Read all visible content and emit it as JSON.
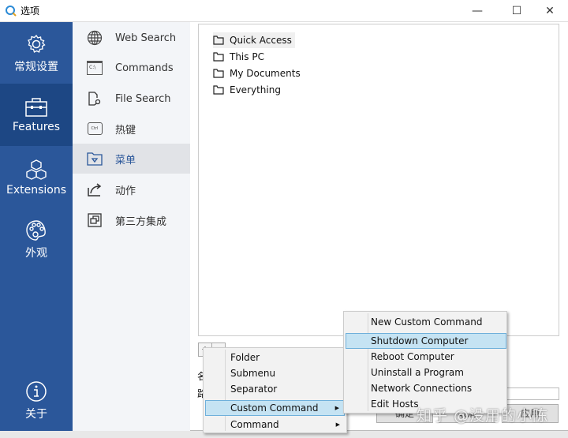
{
  "window": {
    "title": "选项",
    "controls": {
      "minimize": "—",
      "maximize": "☐",
      "close": "✕"
    }
  },
  "nav": {
    "items": [
      {
        "label": "常规设置",
        "icon": "gear-icon"
      },
      {
        "label": "Features",
        "icon": "toolbox-icon",
        "selected": true
      },
      {
        "label": "Extensions",
        "icon": "cubes-icon"
      },
      {
        "label": "外观",
        "icon": "palette-icon"
      },
      {
        "label": "关于",
        "icon": "info-icon"
      }
    ]
  },
  "subnav": {
    "items": [
      {
        "label": "Web Search",
        "icon": "globe-icon"
      },
      {
        "label": "Commands",
        "icon": "terminal-icon",
        "icon_text": "C:\\"
      },
      {
        "label": "File Search",
        "icon": "file-search-icon"
      },
      {
        "label": "热键",
        "icon": "keyboard-ctrl-icon",
        "icon_text": "Ctrl"
      },
      {
        "label": "菜单",
        "icon": "menu-folder-icon",
        "selected": true
      },
      {
        "label": "动作",
        "icon": "share-arrow-icon"
      },
      {
        "label": "第三方集成",
        "icon": "windows-stack-icon"
      }
    ]
  },
  "tree": {
    "items": [
      "Quick Access",
      "This PC",
      "My Documents",
      "Everything"
    ]
  },
  "form": {
    "add": "+",
    "remove": "−",
    "name_label": "名",
    "path_label": "路",
    "buttons": [
      "确定",
      "取消",
      "应用"
    ]
  },
  "context_menu": {
    "items": [
      {
        "label": "Folder"
      },
      {
        "label": "Submenu"
      },
      {
        "label": "Separator"
      },
      {
        "label": "Custom Command",
        "submenu": true,
        "highlighted": true
      },
      {
        "label": "Command",
        "submenu": true
      }
    ]
  },
  "submenu": {
    "items": [
      {
        "label": "New Custom Command"
      },
      {
        "label": "Shutdown Computer",
        "highlighted": true
      },
      {
        "label": "Reboot Computer"
      },
      {
        "label": "Uninstall a Program"
      },
      {
        "label": "Network Connections"
      },
      {
        "label": "Edit Hosts"
      }
    ]
  },
  "watermark": "知乎 @没用的小陈",
  "colors": {
    "sidebar": "#2b579a",
    "sidebar_selected": "#1d4784",
    "highlight": "#c5e3f3"
  }
}
